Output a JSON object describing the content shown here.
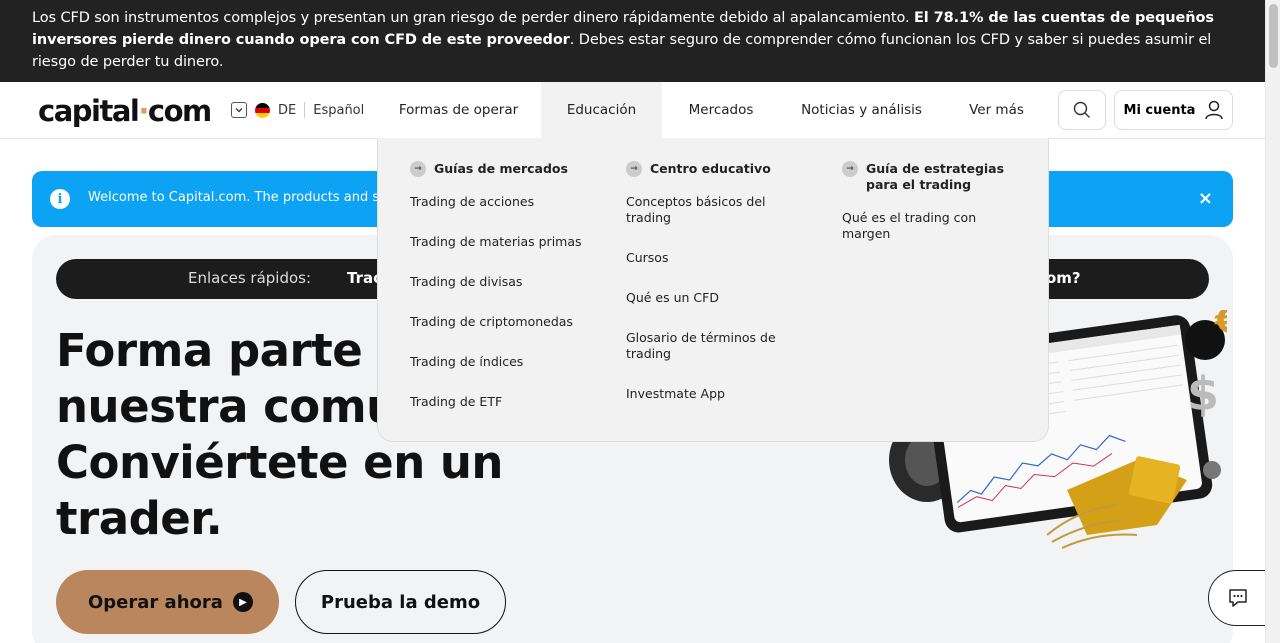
{
  "risk_warning": {
    "part1": "Los CFD son instrumentos complejos y presentan un gran riesgo de perder dinero rápidamente debido al apalancamiento. ",
    "bold": "El 78.1% de las cuentas de pequeños inversores pierde dinero cuando opera con CFD de este proveedor",
    "part2": ". Debes estar seguro de comprender cómo funcionan los CFD y saber si puedes asumir el riesgo de perder tu dinero."
  },
  "header": {
    "logo_left": "capital",
    "logo_dot": "·",
    "logo_right": "com",
    "country_code": "DE",
    "language": "Español",
    "nav": [
      {
        "label": "Formas de operar"
      },
      {
        "label": "Educación"
      },
      {
        "label": "Mercados"
      },
      {
        "label": "Noticias y análisis"
      },
      {
        "label": "Ver más"
      }
    ],
    "account_label": "Mi cuenta"
  },
  "notice": {
    "text": "Welcome to Capital.com. The products and servi",
    "close": "×"
  },
  "quick_links": {
    "label": "Enlaces rápidos:",
    "first": "Trac",
    "last": "om?"
  },
  "hero": {
    "title": "Forma parte d nuestra comun Conviértete en un trader.",
    "title_lines": [
      "Forma parte d",
      "nuestra comur",
      "Conviértete en un",
      "trader."
    ],
    "primary_cta": "Operar ahora",
    "secondary_cta": "Prueba la demo"
  },
  "mega_menu": {
    "columns": [
      {
        "heading": "Guías de mercados",
        "items": [
          "Trading de acciones",
          "Trading de materias primas",
          "Trading de divisas",
          "Trading de criptomonedas",
          "Trading de índices",
          "Trading de ETF"
        ]
      },
      {
        "heading": "Centro educativo",
        "items": [
          "Conceptos básicos del trading",
          "Cursos",
          "Qué es un CFD",
          "Glosario de términos de trading",
          "Investmate App"
        ]
      },
      {
        "heading": "Guía de estrategias para el trading",
        "items": [
          "Qué es el trading con margen"
        ]
      }
    ]
  },
  "colors": {
    "risk_bg": "#222222",
    "notice_bg": "#0ca3f5",
    "primary_cta": "#b9865d",
    "logo_dot": "#e49b5b"
  }
}
